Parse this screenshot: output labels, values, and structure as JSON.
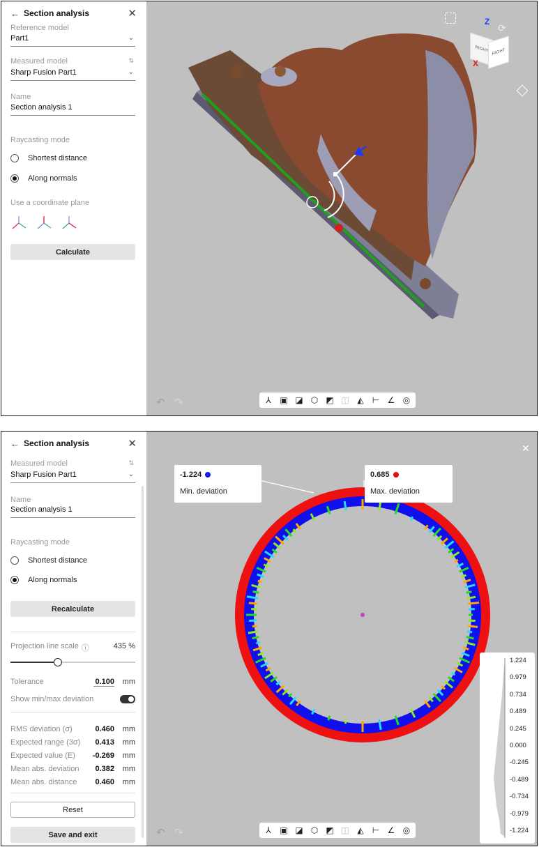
{
  "panel1": {
    "title": "Section analysis",
    "reference_model_label": "Reference model",
    "reference_model_value": "Part1",
    "measured_model_label": "Measured model",
    "measured_model_value": "Sharp Fusion Part1",
    "name_label": "Name",
    "name_value": "Section analysis 1",
    "raycasting_label": "Raycasting mode",
    "radio_shortest": "Shortest distance",
    "radio_normals": "Along normals",
    "coordinate_plane_label": "Use a coordinate plane",
    "calculate": "Calculate"
  },
  "panel2": {
    "title": "Section analysis",
    "measured_model_label": "Measured model",
    "measured_model_value": "Sharp Fusion Part1",
    "name_label": "Name",
    "name_value": "Section analysis 1",
    "raycasting_label": "Raycasting mode",
    "radio_shortest": "Shortest distance",
    "radio_normals": "Along normals",
    "recalculate": "Recalculate",
    "projection_label": "Projection line scale",
    "projection_value": "435 %",
    "projection_fraction": 0.38,
    "tolerance_label": "Tolerance",
    "tolerance_value": "0.100",
    "tolerance_unit": "mm",
    "minmax_label": "Show min/max deviation",
    "minmax_on": true,
    "stats": [
      {
        "label": "RMS deviation (σ)",
        "value": "0.460",
        "unit": "mm"
      },
      {
        "label": "Expected range (3σ)",
        "value": "0.413",
        "unit": "mm"
      },
      {
        "label": "Expected value (E)",
        "value": "-0.269",
        "unit": "mm"
      },
      {
        "label": "Mean abs. deviation",
        "value": "0.382",
        "unit": "mm"
      },
      {
        "label": "Mean abs. distance",
        "value": "0.460",
        "unit": "mm"
      }
    ],
    "reset": "Reset",
    "save_exit": "Save and exit"
  },
  "viewcube": {
    "axis_z": "Z",
    "axis_x": "X",
    "face_right": "RIGHT",
    "face_right_side": "RIGHT"
  },
  "deviation": {
    "min_value": "-1.224",
    "min_label": "Min. deviation",
    "min_color": "#1020e0",
    "max_value": "0.685",
    "max_label": "Max. deviation",
    "max_color": "#e01010",
    "legend_ticks": [
      "1.224",
      "0.979",
      "0.734",
      "0.489",
      "0.245",
      "0.000",
      "-0.245",
      "-0.489",
      "-0.734",
      "-0.979",
      "-1.224"
    ]
  },
  "icons": {
    "back": "←",
    "close": "✕",
    "undo": "↶",
    "redo": "↷",
    "chevron": "⌄",
    "sort": "⇅"
  },
  "toolbar_icons": [
    "axes-icon",
    "view-iso-icon",
    "view-front-icon",
    "view-top-icon",
    "view-side-icon",
    "view-back-icon",
    "section-icon",
    "distance-icon",
    "angle-icon",
    "radius-icon"
  ]
}
